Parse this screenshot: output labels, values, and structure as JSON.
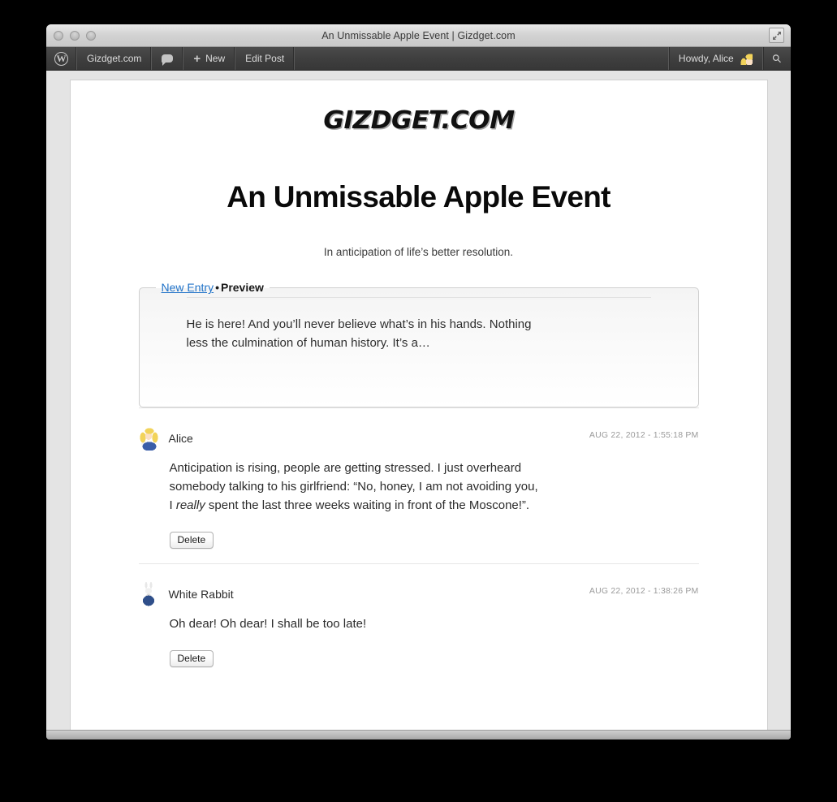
{
  "window": {
    "title": "An Unmissable Apple Event | Gizdget.com",
    "controls": [
      "close",
      "minimize",
      "zoom"
    ],
    "fullscreen_icon": "fullscreen-arrows-icon"
  },
  "adminbar": {
    "wp_logo": "wordpress-logo-icon",
    "site_name": "Gizdget.com",
    "comments_icon": "comment-bubble-icon",
    "new_plus": "+",
    "new_label": "New",
    "edit_post_label": "Edit Post",
    "howdy": "Howdy, Alice",
    "avatar": "user-avatar",
    "search_icon": "search-icon"
  },
  "site": {
    "logo_text": "GIZDGET.COM"
  },
  "post": {
    "title": "An Unmissable Apple Event",
    "subtitle": "In anticipation of life’s better resolution."
  },
  "editor": {
    "tab_new_entry": "New Entry",
    "separator": "•",
    "tab_preview": "Preview",
    "preview_text": "He is here! And you’ll never believe what’s in his hands. Nothing less the culmination of human history. It’s a…"
  },
  "comments": [
    {
      "author": "Alice",
      "avatar": "alice-avatar",
      "timestamp": "AUG 22, 2012 - 1:55:18 PM",
      "body_pre": "Anticipation is rising, people are getting stressed. I just overheard somebody talking to his girlfriend: “No, honey, I am not avoiding you, I ",
      "body_em": "really",
      "body_post": " spent the last three weeks waiting in front of the Moscone!”.",
      "delete_label": "Delete"
    },
    {
      "author": "White Rabbit",
      "avatar": "white-rabbit-avatar",
      "timestamp": "AUG 22, 2012 - 1:38:26 PM",
      "body_pre": "Oh dear! Oh dear! I shall be too late!",
      "body_em": "",
      "body_post": "",
      "delete_label": "Delete"
    }
  ],
  "colors": {
    "link_blue": "#1f72c8",
    "adminbar_bg": "#3f3f3f",
    "page_bg": "#e4e4e4",
    "sheet_bg": "#ffffff",
    "muted_text": "#9a9a9a"
  }
}
